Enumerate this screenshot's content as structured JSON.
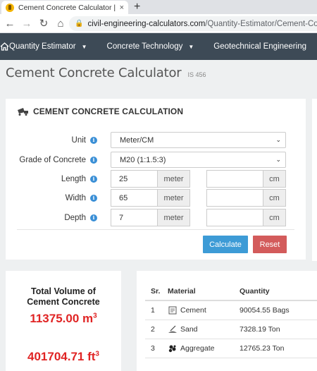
{
  "browser": {
    "tab_title": "Cement Concrete Calculator | PC",
    "tab_close": "×",
    "new_tab": "+",
    "url_domain": "civil-engineering-calculators.com",
    "url_path": "/Quantity-Estimator/Cement-Concrete"
  },
  "nav": {
    "items": [
      "Quantity Estimator",
      "Concrete Technology",
      "Geotechnical Engineering"
    ]
  },
  "page": {
    "title": "Cement Concrete Calculator",
    "standard": "IS 456"
  },
  "calc": {
    "card_title": "CEMENT CONCRETE CALCULATION",
    "unit_label": "Unit",
    "unit_value": "Meter/CM",
    "grade_label": "Grade of Concrete",
    "grade_value": "M20 (1:1.5:3)",
    "length_label": "Length",
    "length_value": "25",
    "width_label": "Width",
    "width_value": "65",
    "depth_label": "Depth",
    "depth_value": "7",
    "unit_meter": "meter",
    "unit_cm": "cm",
    "calculate_label": "Calculate",
    "reset_label": "Reset"
  },
  "result": {
    "volume_title_1": "Total Volume of",
    "volume_title_2": "Cement Concrete",
    "volume_m3": "11375.00 m",
    "volume_ft3": "401704.71 ft",
    "cube": "3"
  },
  "materials": {
    "headers": {
      "sr": "Sr.",
      "material": "Material",
      "quantity": "Quantity"
    },
    "rows": [
      {
        "sr": "1",
        "material": "Cement",
        "quantity": "90054.55 Bags"
      },
      {
        "sr": "2",
        "material": "Sand",
        "quantity": "7328.19 Ton"
      },
      {
        "sr": "3",
        "material": "Aggregate",
        "quantity": "12765.23 Ton"
      }
    ]
  },
  "colors": {
    "nav_bg": "#3d4a56",
    "calculate": "#3d9bd6",
    "reset": "#d35b5b",
    "result_red": "#e02424",
    "info_blue": "#3a8fd6"
  },
  "icons": {
    "info": "i"
  }
}
